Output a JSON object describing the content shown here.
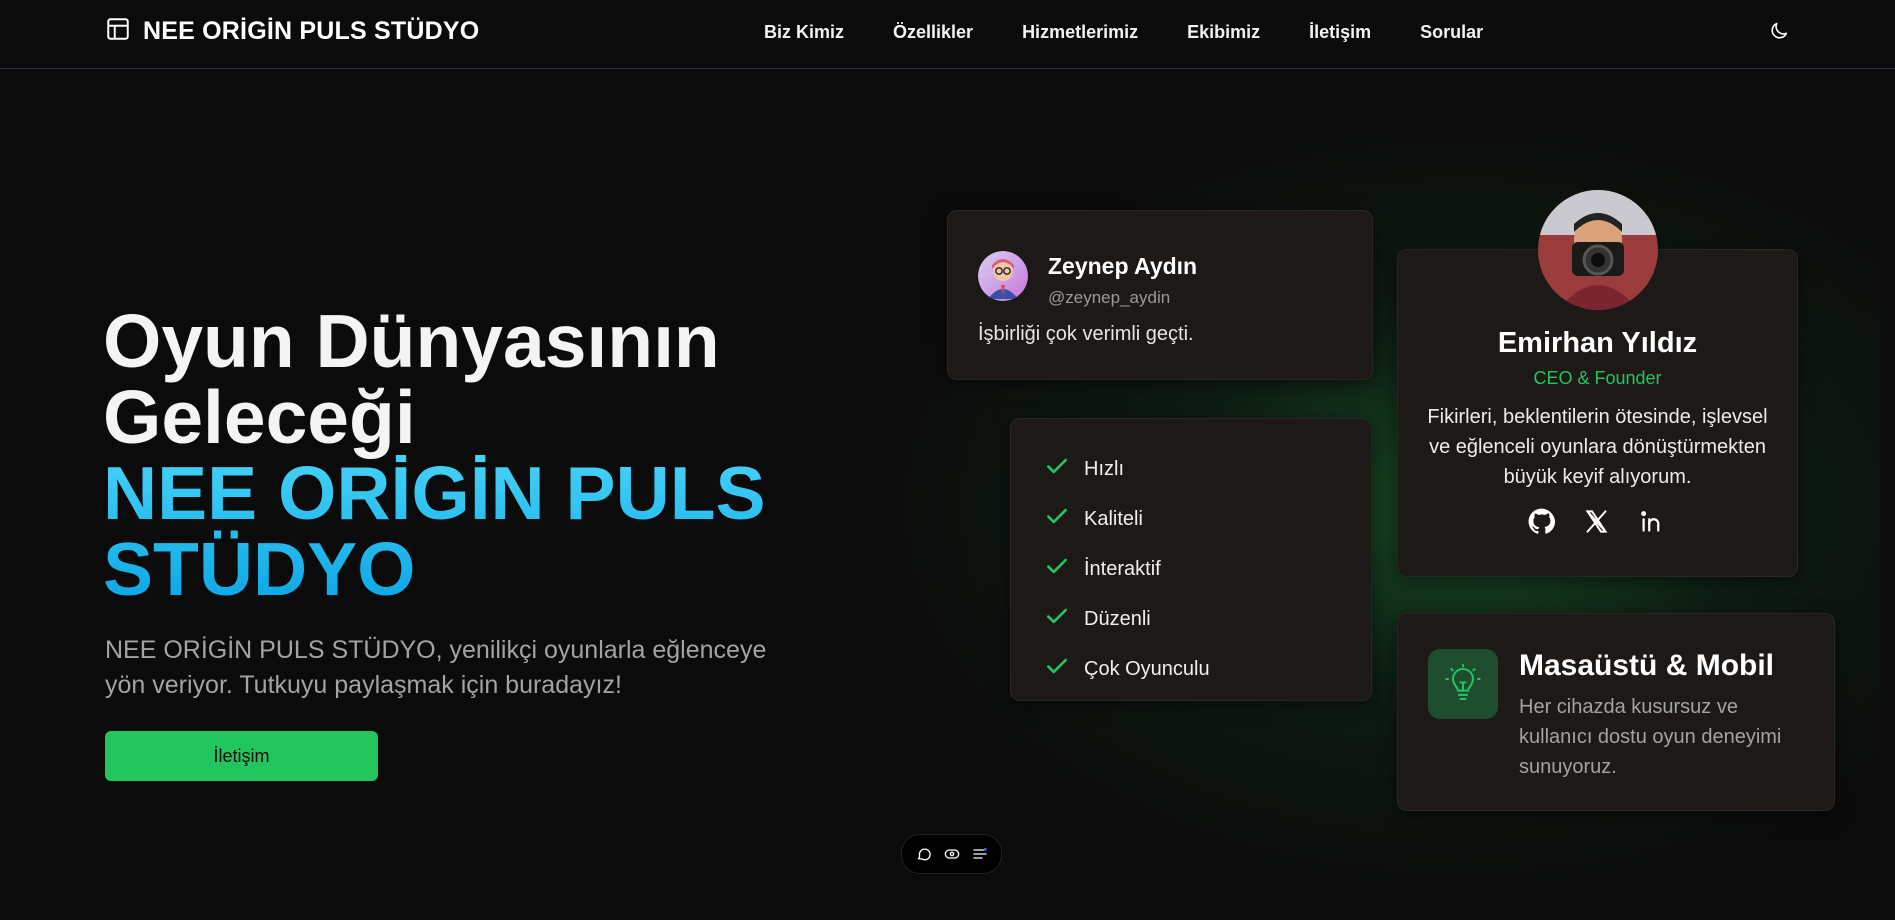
{
  "header": {
    "brand": "NEE ORİGİN PULS STÜDYO",
    "nav": [
      "Biz Kimiz",
      "Özellikler",
      "Hizmetlerimiz",
      "Ekibimiz",
      "İletişim",
      "Sorular"
    ],
    "icons": {
      "logo": "layout-panel-icon",
      "theme_toggle": "moon-icon"
    }
  },
  "hero": {
    "title_line1": "Oyun Dünyasının",
    "title_line2": "Geleceği",
    "title_accent": "NEE ORİGİN PULS STÜDYO",
    "description": "NEE ORİGİN PULS STÜDYO, yenilikçi oyunlarla eğlenceye yön veriyor. Tutkuyu paylaşmak için buradayız!",
    "cta_label": "İletişim"
  },
  "testimonial": {
    "name": "Zeynep Aydın",
    "handle": "@zeynep_aydin",
    "text": "İşbirliği çok verimli geçti."
  },
  "features": [
    "Hızlı",
    "Kaliteli",
    "İnteraktif",
    "Düzenli",
    "Çok Oyunculu"
  ],
  "team_member": {
    "name": "Emirhan Yıldız",
    "role": "CEO & Founder",
    "bio": "Fikirleri, beklentilerin ötesinde, işlevsel ve eğlenceli oyunlara dönüştürmekten büyük keyif alıyorum.",
    "socials": [
      "github-icon",
      "x-icon",
      "linkedin-icon"
    ]
  },
  "platform_card": {
    "title": "Masaüstü & Mobil",
    "description": "Her cihazda kusursuz ve kullanıcı dostu oyun deneyimi sunuyoruz.",
    "icon": "lightbulb-icon"
  },
  "dock": {
    "icons": [
      "chat-icon",
      "eye-icon",
      "menu-lines-icon"
    ]
  },
  "colors": {
    "background": "#0b0b0b",
    "accent_green": "#22c55e",
    "accent_blue": "#0ea5e9",
    "card": "#1c1917"
  }
}
